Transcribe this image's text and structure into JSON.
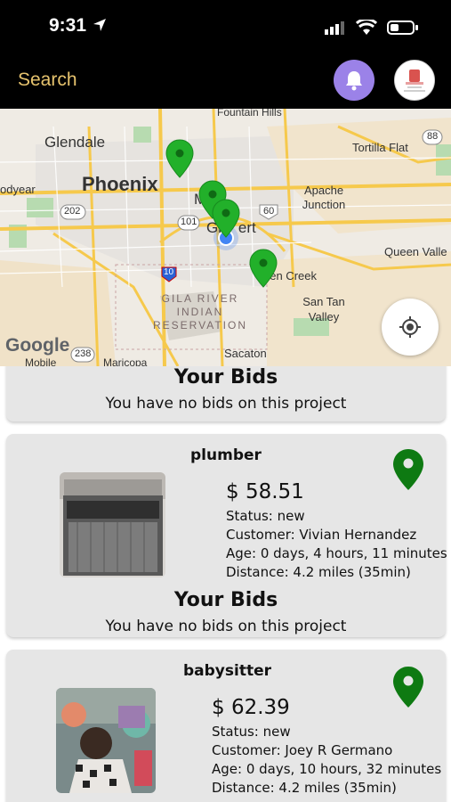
{
  "status_bar": {
    "time": "9:31"
  },
  "header": {
    "search_label": "Search"
  },
  "map": {
    "labels": {
      "fountain_hills": "Fountain Hills",
      "glendale": "Glendale",
      "tortilla_flat": "Tortilla Flat",
      "goodyear": "odyear",
      "phoenix": "Phoenix",
      "mesa": "Me",
      "apache_junction": "Apache Junction",
      "gilbert": "Gi    ert",
      "queen_valley": "Queen Valle",
      "queen_creek": "een Creek",
      "san_tan_valley": "San Tan Valley",
      "gila_river": "GILA RIVER INDIAN RESERVATION",
      "google": "Google",
      "mobile": "Mobile",
      "maricopa": "Maricopa",
      "sacaton": "Sacaton",
      "shield_88": "88",
      "shield_202": "202",
      "shield_101": "101",
      "shield_60": "60",
      "shield_10": "10",
      "shield_238": "238"
    }
  },
  "bids_card_1": {
    "title": "Your Bids",
    "subtitle": "You have no bids on this project"
  },
  "jobs": [
    {
      "title": "plumber",
      "price": "$ 58.51",
      "status": "Status: new",
      "customer": "Customer: Vivian Hernandez",
      "age": "Age: 0 days, 4 hours, 11 minutes",
      "distance": "Distance: 4.2 miles (35min)",
      "bids_title": "Your Bids",
      "bids_subtitle": "You have no bids on this project"
    },
    {
      "title": "babysitter",
      "price": "$ 62.39",
      "status": "Status: new",
      "customer": "Customer: Joey R Germano",
      "age": "Age: 0 days, 10 hours, 32 minutes",
      "distance": "Distance: 4.2 miles (35min)"
    }
  ],
  "colors": {
    "header_bg": "#000000",
    "search_text": "#e6c36e",
    "bell_bg": "#9b82e8",
    "pin_green": "#0e7a12",
    "map_pin": "#22b02a",
    "card_bg": "#e6e6e6"
  }
}
